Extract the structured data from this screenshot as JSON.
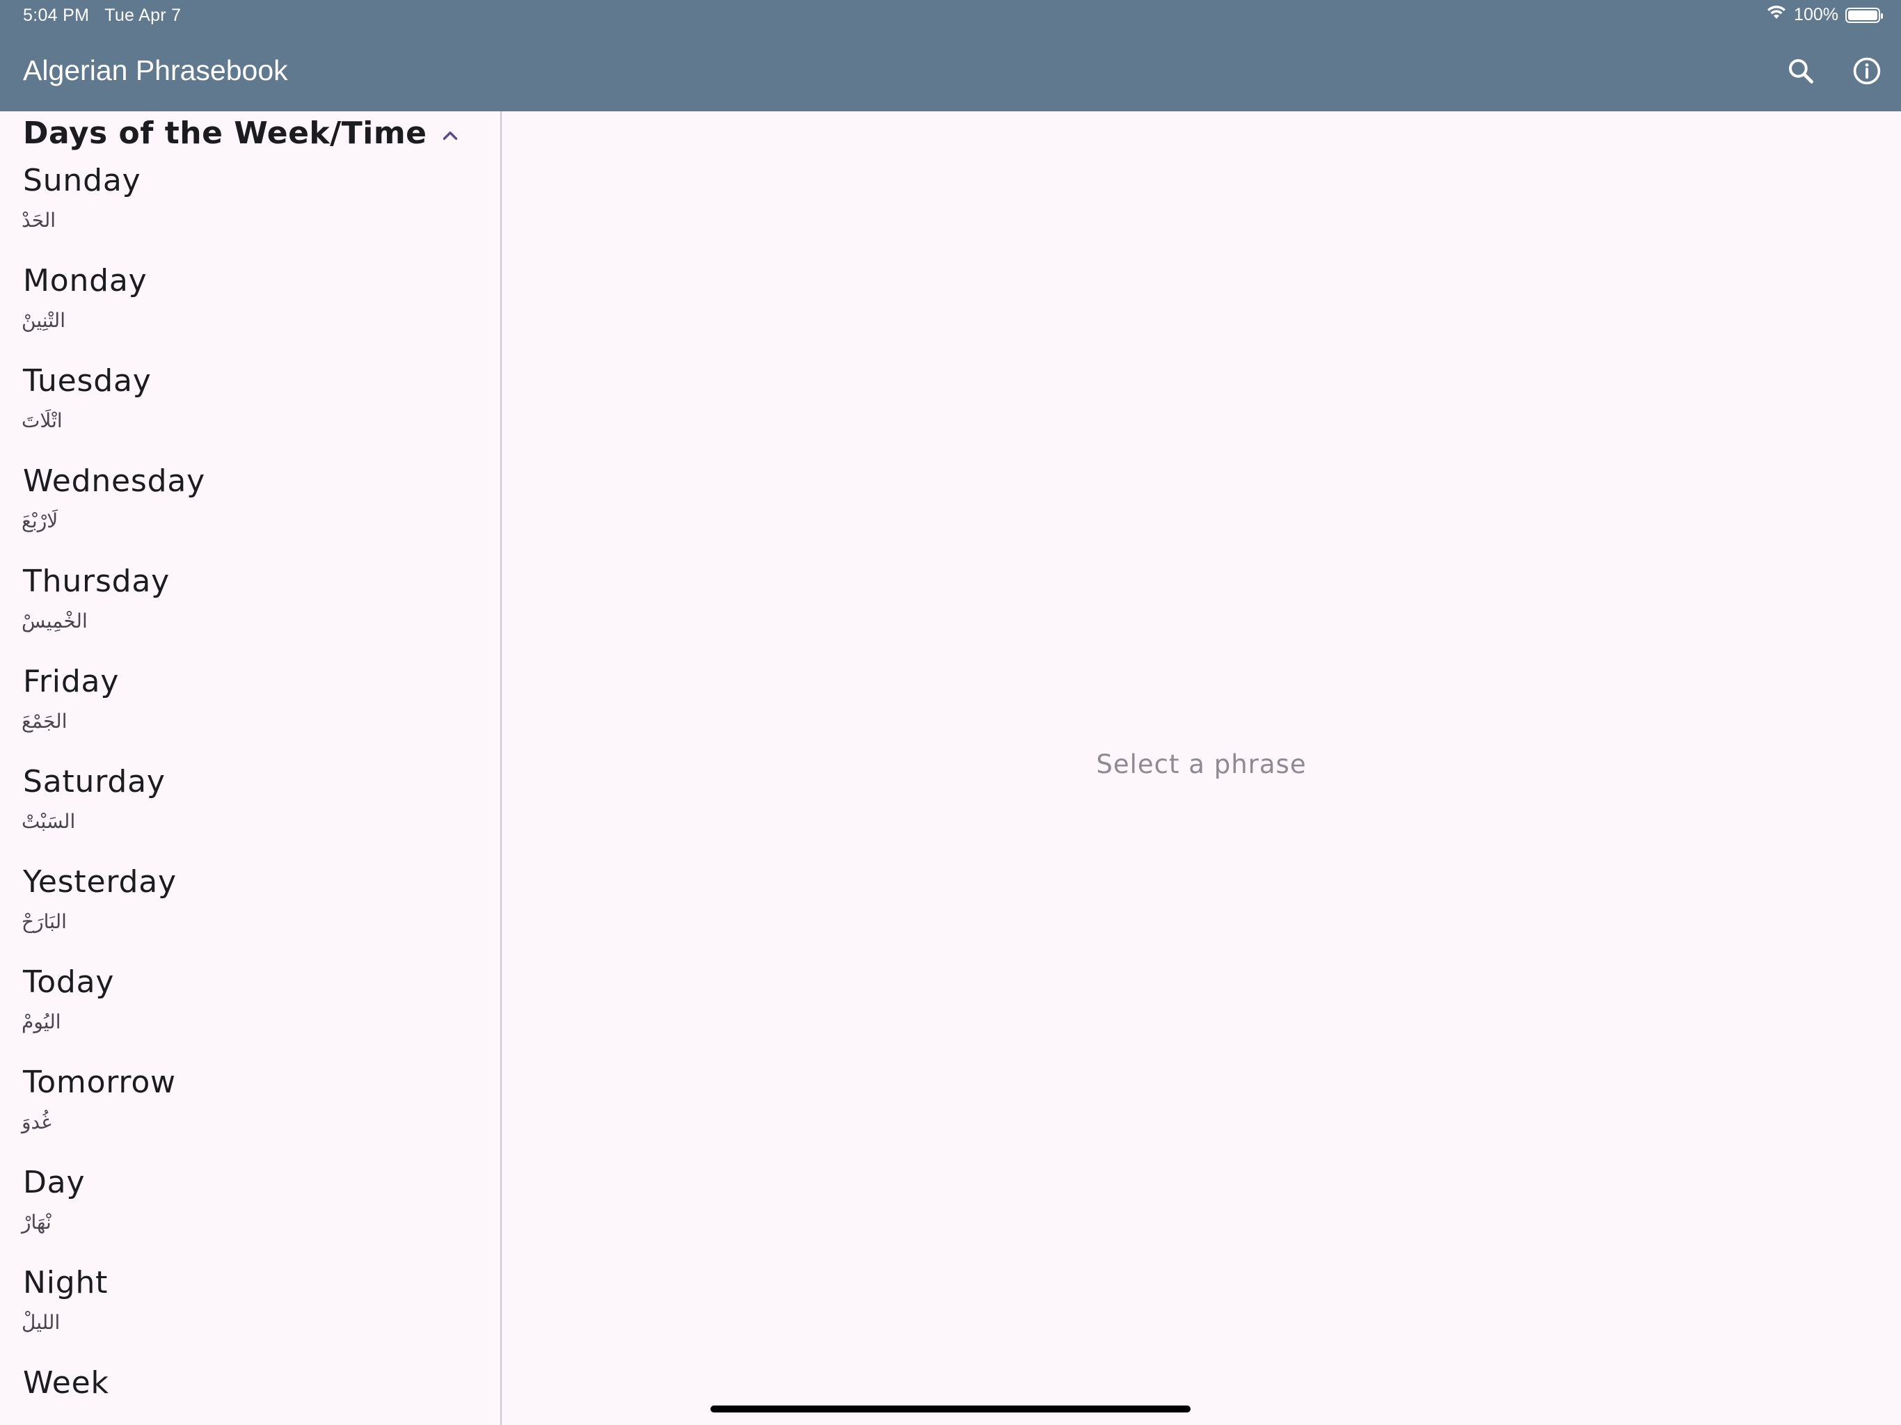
{
  "status_bar": {
    "time": "5:04 PM",
    "date": "Tue Apr 7",
    "battery": "100%",
    "battery_level": 1.0
  },
  "app_bar": {
    "title": "Algerian Phrasebook",
    "icons": [
      "search-icon",
      "info-icon"
    ]
  },
  "section": {
    "title": "Days of the Week/Time",
    "icon": "chevron-up-icon"
  },
  "phrases": [
    {
      "en": "Sunday",
      "ar": "الحَدْ"
    },
    {
      "en": "Monday",
      "ar": "التْنِينْ"
    },
    {
      "en": "Tuesday",
      "ar": "اتْلَاتَ"
    },
    {
      "en": "Wednesday",
      "ar": "لَارْبْعَ"
    },
    {
      "en": "Thursday",
      "ar": "الخْمِيسْ"
    },
    {
      "en": "Friday",
      "ar": "الجَمْعَ"
    },
    {
      "en": "Saturday",
      "ar": "السَبْتْ"
    },
    {
      "en": "Yesterday",
      "ar": "البَارَحْ"
    },
    {
      "en": "Today",
      "ar": "اليُومْ"
    },
    {
      "en": "Tomorrow",
      "ar": "غُدوَ"
    },
    {
      "en": "Day",
      "ar": "نْهَارْ"
    },
    {
      "en": "Night",
      "ar": "الليلْ"
    },
    {
      "en": "Week",
      "ar": ""
    }
  ],
  "detail": {
    "placeholder": "Select a phrase"
  },
  "colors": {
    "app_bar": "#60798e",
    "background": "#fdf7fc",
    "accent": "#5b4b8a"
  }
}
